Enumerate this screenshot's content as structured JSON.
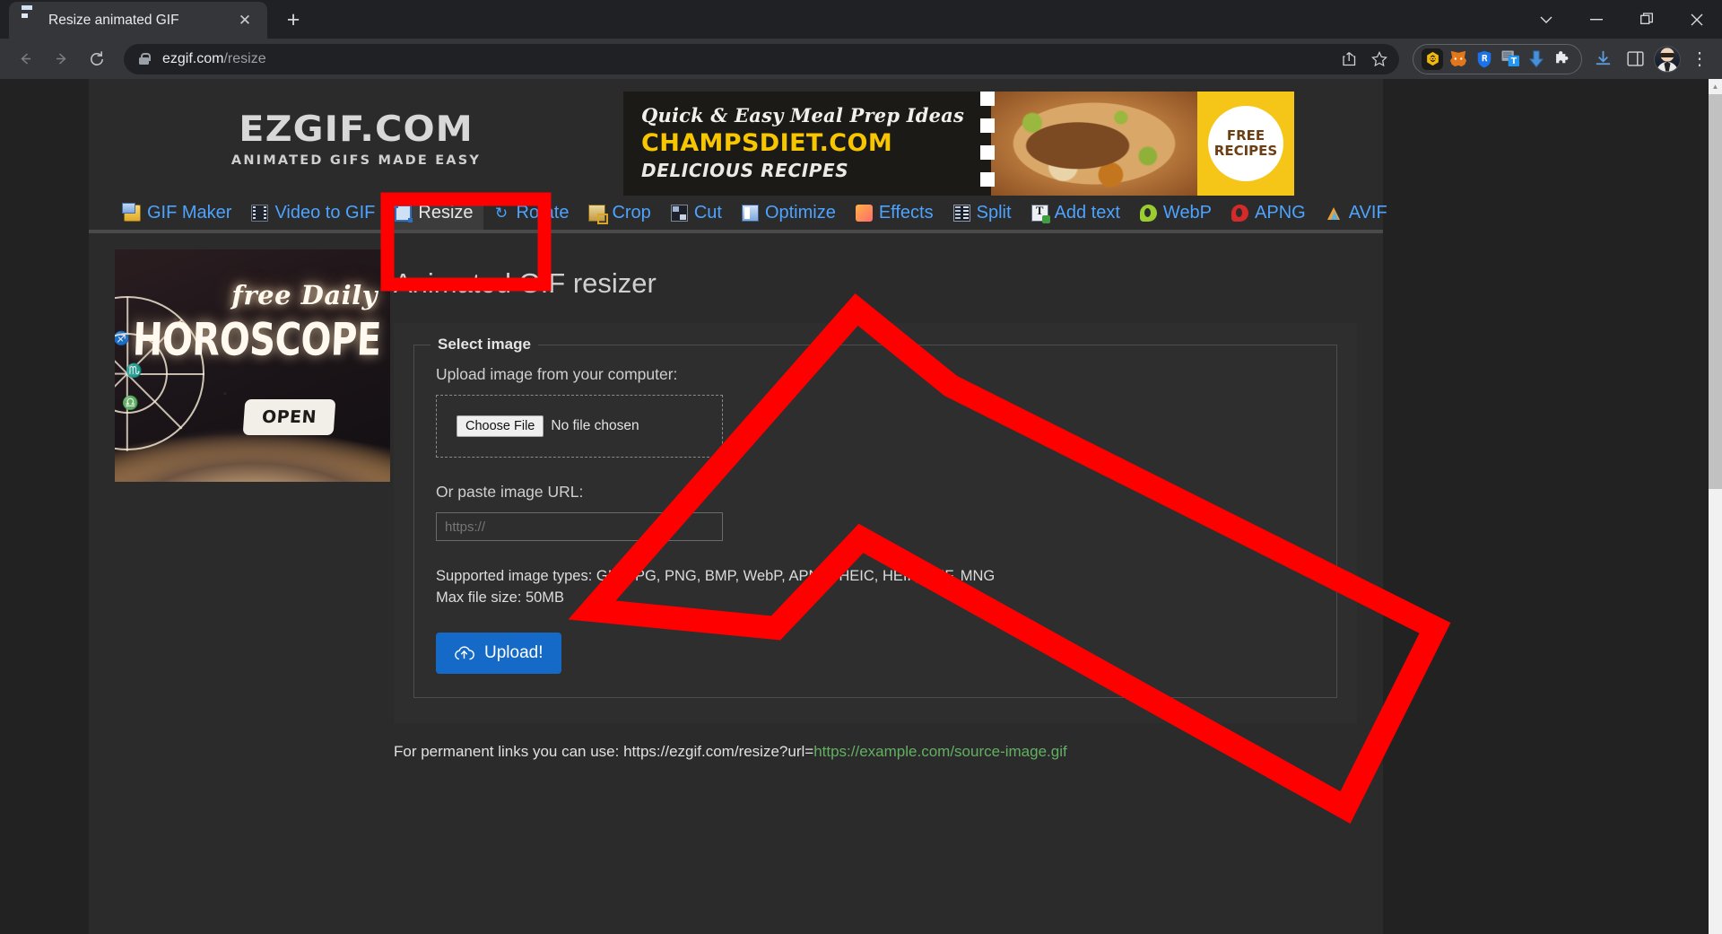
{
  "browser": {
    "tab": {
      "title": "Resize animated GIF",
      "favicon": "gif-file-icon",
      "close_label": "✕"
    },
    "new_tab_label": "+",
    "window_controls": {
      "minimize": "—",
      "maximize": "❐",
      "close": "✕",
      "chevron": "∨"
    },
    "nav": {
      "back": "←",
      "forward": "→",
      "reload": "⟳"
    },
    "omnibox": {
      "lock": "lock-icon",
      "url_domain": "ezgif.com",
      "url_path": "/resize",
      "share_label": "share-icon",
      "bookmark_label": "☆"
    },
    "extensions": [
      {
        "name": "bnb-extension-icon",
        "color": "#f0b90b"
      },
      {
        "name": "metamask-extension-icon",
        "color": "#e2761b"
      },
      {
        "name": "shield-extension-icon",
        "color": "#1a73e8"
      },
      {
        "name": "transpose-extension-icon",
        "color": "#2196f3"
      },
      {
        "name": "downloader-extension-icon",
        "color": "#3d8fd1"
      },
      {
        "name": "puzzle-extensions-icon",
        "color": "#e8eaed"
      }
    ],
    "toolbar_right": [
      {
        "name": "downloads-icon",
        "glyph": "⤓"
      },
      {
        "name": "side-panel-icon",
        "glyph": "▢"
      },
      {
        "name": "profile-avatar",
        "glyph": ""
      },
      {
        "name": "chrome-menu-icon",
        "glyph": "⋮"
      }
    ]
  },
  "site": {
    "logo": {
      "main": "EZGIF.COM",
      "sub": "ANIMATED GIFS MADE EASY"
    },
    "ad_banner": {
      "line1": "Quick & Easy Meal Prep Ideas",
      "line2": "CHAMPSDIET.COM",
      "line3": "DELICIOUS RECIPES",
      "badge_line1": "FREE",
      "badge_line2": "RECIPES"
    },
    "nav": [
      {
        "label": "GIF Maker",
        "icon": "gif-maker-icon",
        "active": false
      },
      {
        "label": "Video to GIF",
        "icon": "video-to-gif-icon",
        "active": false
      },
      {
        "label": "Resize",
        "icon": "resize-icon",
        "active": true
      },
      {
        "label": "Rotate",
        "icon": "rotate-icon",
        "active": false
      },
      {
        "label": "Crop",
        "icon": "crop-icon",
        "active": false
      },
      {
        "label": "Cut",
        "icon": "cut-icon",
        "active": false
      },
      {
        "label": "Optimize",
        "icon": "optimize-icon",
        "active": false
      },
      {
        "label": "Effects",
        "icon": "effects-icon",
        "active": false
      },
      {
        "label": "Split",
        "icon": "split-icon",
        "active": false
      },
      {
        "label": "Add text",
        "icon": "add-text-icon",
        "active": false
      },
      {
        "label": "WebP",
        "icon": "webp-icon",
        "active": false
      },
      {
        "label": "APNG",
        "icon": "apng-icon",
        "active": false
      },
      {
        "label": "AVIF",
        "icon": "avif-icon",
        "active": false
      }
    ],
    "side_ad": {
      "line1": "free Daily",
      "line2": "HOROSCOPE",
      "button": "OPEN"
    },
    "main": {
      "title": "Animated GIF resizer",
      "legend": "Select image",
      "upload_label": "Upload image from your computer:",
      "choose_file_button": "Choose File",
      "no_file_text": "No file chosen",
      "url_label": "Or paste image URL:",
      "url_placeholder": "https://",
      "supported_types": "Supported image types: GIF, JPG, PNG, BMP, WebP, APNG, HEIC, HEIF, AVIF, MNG",
      "max_file_size": "Max file size: 50MB",
      "upload_button": "Upload!",
      "permalink_prefix": "For permanent links you can use: https://ezgif.com/resize?url=",
      "permalink_example": "https://example.com/source-image.gif"
    }
  },
  "annotations": {
    "highlight_color": "#FF0000",
    "highlight_target": "Resize",
    "arrow_points": "large red outlined arrow pointing up-left at the Resize tab"
  }
}
